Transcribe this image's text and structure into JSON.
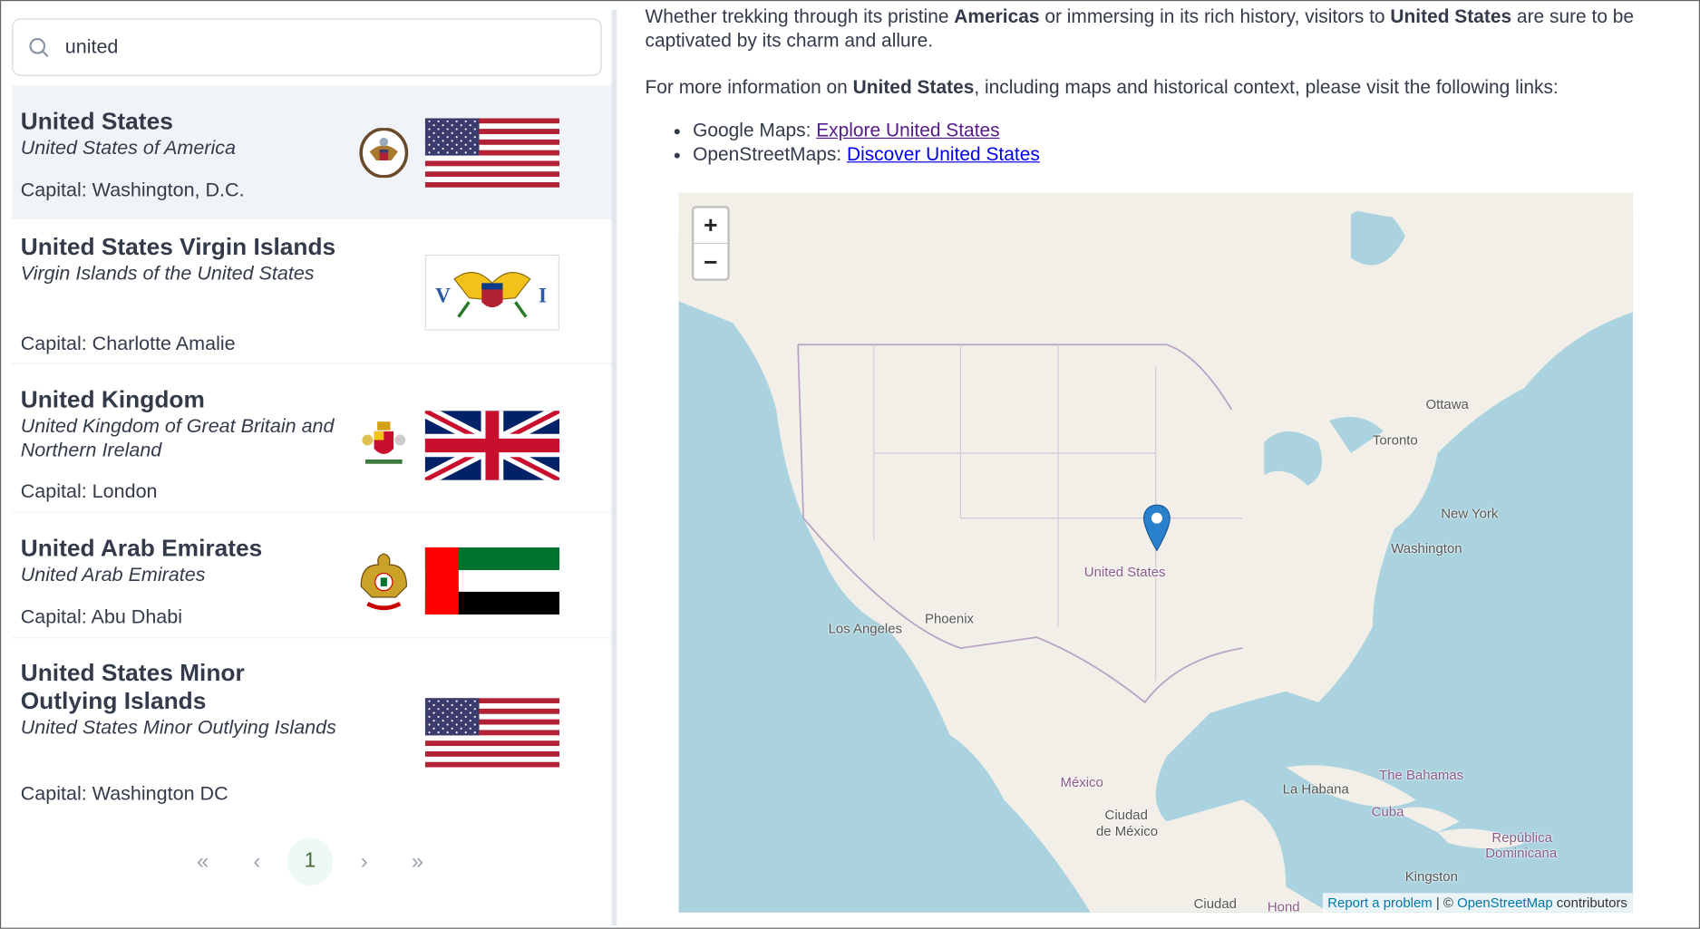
{
  "search": {
    "value": "united",
    "icon": "search-icon"
  },
  "countries": [
    {
      "name": "United States",
      "official": "United States of America",
      "capital": "Capital: Washington, D.C.",
      "flag": "us",
      "emblem": "us-seal"
    },
    {
      "name": "United States Virgin Islands",
      "official": "Virgin Islands of the United States",
      "capital": "Capital: Charlotte Amalie",
      "flag": "vi",
      "emblem": ""
    },
    {
      "name": "United Kingdom",
      "official": "United Kingdom of Great Britain and Northern Ireland",
      "capital": "Capital: London",
      "flag": "gb",
      "emblem": "uk-coat-of-arms"
    },
    {
      "name": "United Arab Emirates",
      "official": "United Arab Emirates",
      "capital": "Capital: Abu Dhabi",
      "flag": "ae",
      "emblem": "uae-emblem"
    },
    {
      "name": "United States Minor Outlying Islands",
      "official": "United States Minor Outlying Islands",
      "capital": "Capital: Washington DC",
      "flag": "us",
      "emblem": ""
    }
  ],
  "pagination": {
    "first": "«",
    "prev": "‹",
    "current": "1",
    "next": "›",
    "last": "»"
  },
  "detail": {
    "p1_a": "Whether trekking through its pristine ",
    "p1_b": "Americas",
    "p1_c": " or immersing in its rich history, visitors to ",
    "p1_d": "United States",
    "p1_e": " are sure to be captivated by its charm and allure.",
    "p2_a": "For more information on ",
    "p2_b": "United States",
    "p2_c": ", including maps and historical context, please visit the following links:",
    "links": [
      {
        "prefix": "Google Maps: ",
        "label": "Explore United States"
      },
      {
        "prefix": "OpenStreetMaps: ",
        "label": "Discover United States"
      }
    ]
  },
  "map": {
    "zoom_in": "+",
    "zoom_out": "−",
    "labels": {
      "ottawa": "Ottawa",
      "toronto": "Toronto",
      "newyork": "New York",
      "washington": "Washington",
      "us": "United States",
      "la": "Los Angeles",
      "phoenix": "Phoenix",
      "mexico": "México",
      "cdmx1": "Ciudad",
      "cdmx2": "de México",
      "habana": "La Habana",
      "bahamas": "The Bahamas",
      "cuba": "Cuba",
      "rd1": "República",
      "rd2": "Dominicana",
      "kingston": "Kingston",
      "ciudad": "Ciudad",
      "hond": "Hond"
    },
    "attribution": {
      "report": "Report a problem",
      "sep": " | © ",
      "osm": "OpenStreetMap",
      "contrib": " contributors"
    },
    "colors": {
      "water": "#aad3df",
      "land": "#f2efe9",
      "marker": "#2a81cb"
    }
  }
}
